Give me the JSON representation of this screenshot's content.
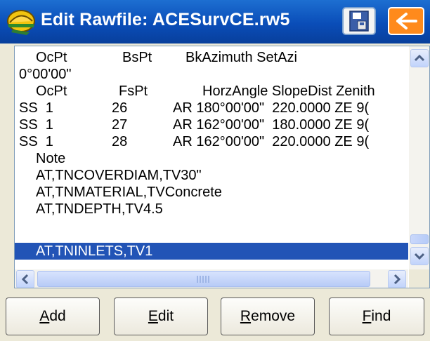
{
  "window": {
    "title": "Edit Rawfile: ACESurvCE.rw5"
  },
  "icons": {
    "app": "surveyor-hardhat-icon",
    "save": "save-disk-icon",
    "back": "arrow-left-icon"
  },
  "list": {
    "rows": [
      {
        "cols": [
          "",
          "OcPt",
          "BsPt",
          "BkAzimuth SetAzi"
        ],
        "selected": false
      },
      {
        "cols": [
          "0°00'00\""
        ],
        "selected": false
      },
      {
        "cols": [
          "",
          "OcPt",
          "FsPt",
          "HorzAngle SlopeDist Zenith"
        ],
        "selected": false
      },
      {
        "cols": [
          "SS  1",
          "26",
          "AR 180°00'00\"  220.0000 ZE 9("
        ],
        "selected": false
      },
      {
        "cols": [
          "SS  1",
          "27",
          "AR 162°00'00\"  180.0000 ZE 9("
        ],
        "selected": false
      },
      {
        "cols": [
          "SS  1",
          "28",
          "AR 162°00'00\"  220.0000 ZE 9("
        ],
        "selected": false
      },
      {
        "cols": [
          "Note"
        ],
        "selected": false
      },
      {
        "cols": [
          "AT,TNCOVERDIAM,TV30\""
        ],
        "selected": false
      },
      {
        "cols": [
          "AT,TNMATERIAL,TVConcrete"
        ],
        "selected": false
      },
      {
        "cols": [
          "AT,TNDEPTH,TV4.5"
        ],
        "selected": false
      },
      {
        "cols": [
          "AT,TNINLETS,TV1"
        ],
        "selected": true
      }
    ]
  },
  "scroll": {
    "up": "▲",
    "down": "▼",
    "left": "◀",
    "right": "▶"
  },
  "buttons": [
    {
      "pre": "",
      "mnemonic": "A",
      "post": "dd"
    },
    {
      "pre": "",
      "mnemonic": "E",
      "post": "dit"
    },
    {
      "pre": "",
      "mnemonic": "R",
      "post": "emove"
    },
    {
      "pre": "",
      "mnemonic": "F",
      "post": "ind"
    }
  ]
}
